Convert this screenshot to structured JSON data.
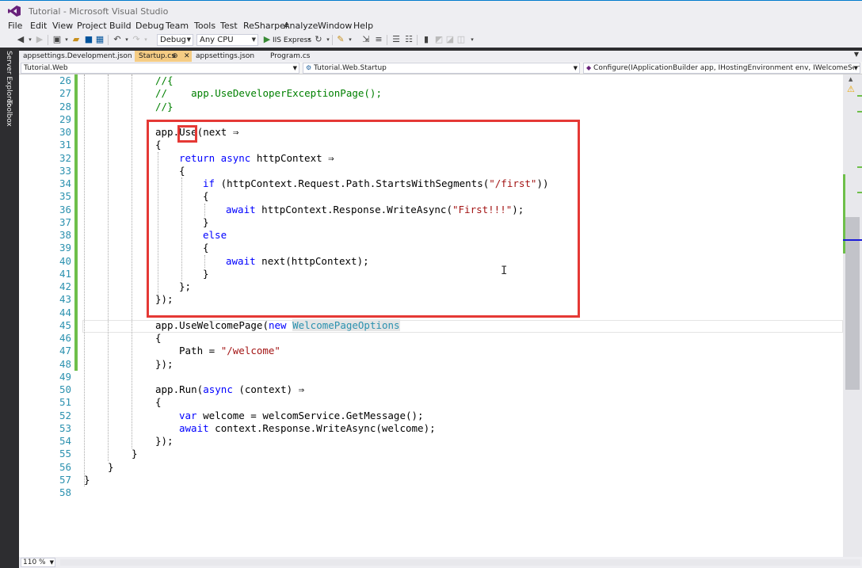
{
  "window": {
    "title": "Tutorial - Microsoft Visual Studio"
  },
  "menu": [
    "File",
    "Edit",
    "View",
    "Project",
    "Build",
    "Debug",
    "Team",
    "Tools",
    "Test",
    "ReSharper",
    "Analyze",
    "Window",
    "Help"
  ],
  "toolbar": {
    "configuration": "Debug",
    "platform": "Any CPU",
    "run_target": "IIS Express"
  },
  "side_tabs": [
    "Server Explorer",
    "Toolbox"
  ],
  "doc_tabs": [
    {
      "label": "appsettings.Development.json",
      "active": false
    },
    {
      "label": "Startup.cs",
      "active": true
    },
    {
      "label": "appsettings.json",
      "active": false
    },
    {
      "label": "Program.cs",
      "active": false
    }
  ],
  "tab_glyphs": {
    "pin": "⊕",
    "close": "✕"
  },
  "navbar": {
    "project": "Tutorial.Web",
    "type": "Tutorial.Web.Startup",
    "member": "Configure(IApplicationBuilder app, IHostingEnvironment env, IWelcomeService welcom"
  },
  "editor": {
    "line_numbers": [
      "26",
      "27",
      "28",
      "29",
      "30",
      "31",
      "32",
      "33",
      "34",
      "35",
      "36",
      "37",
      "38",
      "39",
      "40",
      "41",
      "42",
      "43",
      "44",
      "45",
      "46",
      "47",
      "48",
      "49",
      "50",
      "51",
      "52",
      "53",
      "54",
      "55",
      "56",
      "57",
      "58"
    ],
    "code": {
      "l26": "//{",
      "l27": "//    app.UseDeveloperExceptionPage();",
      "l28": "//}",
      "l30_a": "app.",
      "l30_b": "Use",
      "l30_c": "(next ⇒",
      "l31": "{",
      "l32_kw": "return async",
      "l32_rest": " httpContext ⇒",
      "l33": "{",
      "l34_kw": "if",
      "l34_a": " (httpContext.Request.Path.StartsWithSegments(",
      "l34_str": "\"/first\"",
      "l34_b": "))",
      "l35": "{",
      "l36_kw": "await",
      "l36_a": " httpContext.Response.WriteAsync(",
      "l36_str": "\"First!!!\"",
      "l36_b": ");",
      "l37": "}",
      "l38_kw": "else",
      "l39": "{",
      "l40_kw": "await",
      "l40_a": " next(httpContext);",
      "l41": "}",
      "l42": "};",
      "l43": "});",
      "l45_a": "app.UseWelcomePage(",
      "l45_kw": "new",
      "l45_type": "WelcomePageOptions",
      "l46": "{",
      "l47_a": "Path = ",
      "l47_str": "\"/welcome\"",
      "l48": "});",
      "l50_a": "app.Run(",
      "l50_kw": "async",
      "l50_b": " (context) ⇒",
      "l51": "{",
      "l52_kw": "var",
      "l52_a": " welcome = welcomService.GetMessage();",
      "l53_kw": "await",
      "l53_a": " context.Response.WriteAsync(welcome);",
      "l54": "});",
      "l55": "}",
      "l56": "}",
      "l57": "}"
    }
  },
  "zoom": "110 %",
  "colors": {
    "highlight_border": "#e53935",
    "keyword": "#0000ff",
    "string": "#a31515",
    "comment": "#008000",
    "line_number": "#2b91af",
    "active_tab": "#f5cc84"
  }
}
